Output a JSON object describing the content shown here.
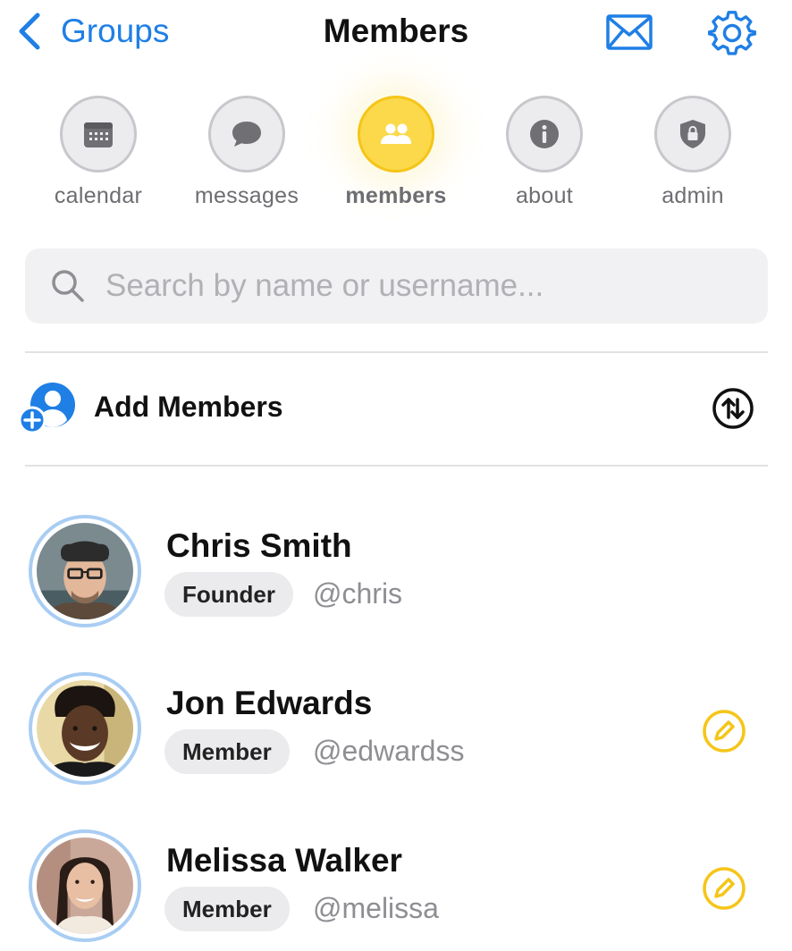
{
  "header": {
    "back_label": "Groups",
    "title": "Members",
    "mail_icon": "mail-icon",
    "settings_icon": "gear-icon"
  },
  "tabs": [
    {
      "label": "calendar",
      "icon": "calendar-icon",
      "active": false
    },
    {
      "label": "messages",
      "icon": "chat-bubble-icon",
      "active": false
    },
    {
      "label": "members",
      "icon": "people-icon",
      "active": true
    },
    {
      "label": "about",
      "icon": "info-icon",
      "active": false
    },
    {
      "label": "admin",
      "icon": "shield-lock-icon",
      "active": false
    }
  ],
  "search": {
    "placeholder": "Search by name or username...",
    "value": ""
  },
  "add_members": {
    "label": "Add Members"
  },
  "members": [
    {
      "name": "Chris Smith",
      "role": "Founder",
      "username": "@chris",
      "editable": false
    },
    {
      "name": "Jon Edwards",
      "role": "Member",
      "username": "@edwardss",
      "editable": true
    },
    {
      "name": "Melissa Walker",
      "role": "Member",
      "username": "@melissa",
      "editable": true
    }
  ],
  "colors": {
    "accent_blue": "#1f7fe5",
    "active_tab_yellow": "#fbd94a",
    "edit_yellow": "#f5c518",
    "avatar_ring": "#a9cdf3"
  }
}
